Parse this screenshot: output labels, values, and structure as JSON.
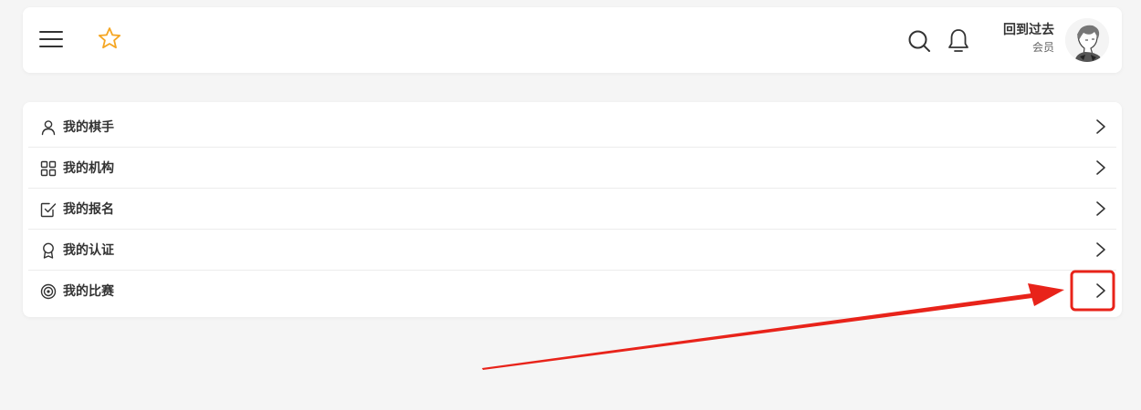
{
  "header": {
    "user_name": "回到过去",
    "user_role": "会员",
    "star_color": "#f5a623"
  },
  "menu": {
    "items": [
      {
        "label": "我的棋手",
        "icon": "user-icon"
      },
      {
        "label": "我的机构",
        "icon": "grid-icon"
      },
      {
        "label": "我的报名",
        "icon": "checkbox-icon"
      },
      {
        "label": "我的认证",
        "icon": "badge-icon"
      },
      {
        "label": "我的比赛",
        "icon": "target-icon"
      }
    ]
  },
  "annotation": {
    "color": "#e8231a"
  }
}
